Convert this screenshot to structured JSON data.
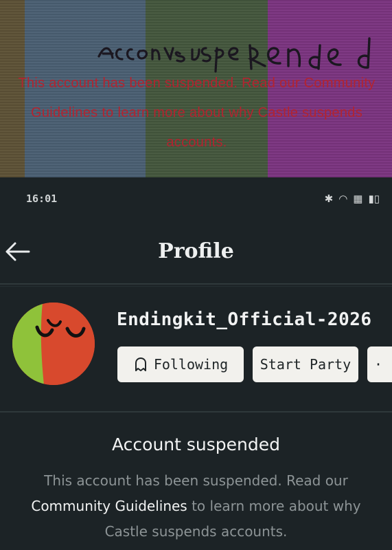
{
  "banner": {
    "scribble_text": "Account suspended",
    "body": "This account has been suspended. Read our Community Guidelines to learn more about why Castle suspends accounts."
  },
  "status_bar": {
    "time": "16:01"
  },
  "header": {
    "title": "Profile"
  },
  "profile": {
    "username": "Endingkit_Official-2026",
    "following_label": "Following",
    "start_party_label": "Start Party"
  },
  "suspension": {
    "title": "Account suspended",
    "body_before": "This account has been suspended. Read our ",
    "link_text": "Community Guidelines",
    "body_after": " to learn more about why Castle suspends accounts."
  },
  "colors": {
    "banner_text": "#b3232f",
    "background": "#1c2326",
    "button_bg": "#f2f1ed",
    "avatar_red": "#d8492d",
    "avatar_green": "#8fc23a"
  }
}
